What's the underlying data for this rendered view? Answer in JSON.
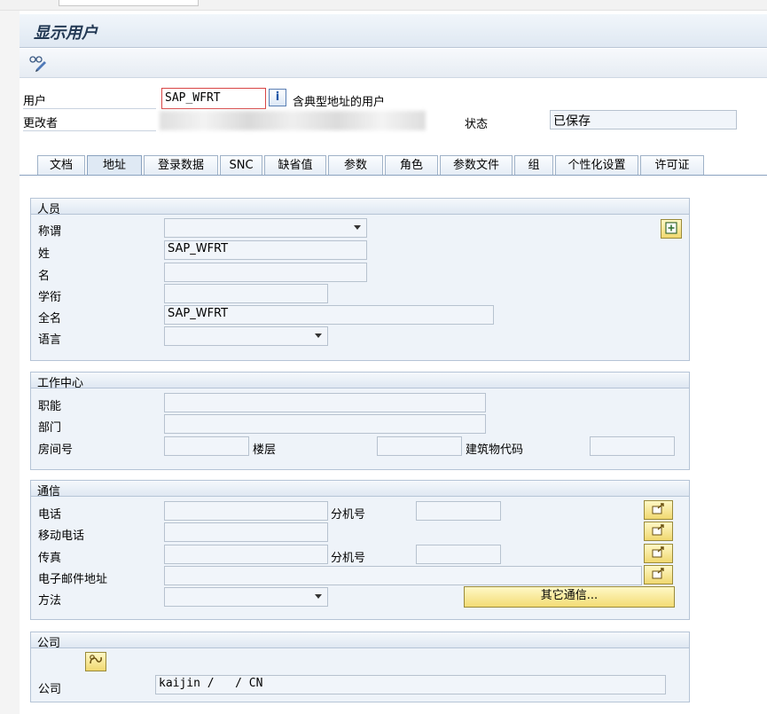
{
  "window": {
    "title": "显示用户"
  },
  "header": {
    "user_label": "用户",
    "user_value": "SAP_WFRT",
    "user_desc": "含典型地址的用户",
    "changed_by_label": "更改者",
    "status_label": "状态",
    "status_value": "已保存"
  },
  "tabs": [
    {
      "label": "文档",
      "active": false
    },
    {
      "label": "地址",
      "active": true
    },
    {
      "label": "登录数据",
      "active": false
    },
    {
      "label": "SNC",
      "active": false
    },
    {
      "label": "缺省值",
      "active": false
    },
    {
      "label": "参数",
      "active": false
    },
    {
      "label": "角色",
      "active": false
    },
    {
      "label": "参数文件",
      "active": false
    },
    {
      "label": "组",
      "active": false
    },
    {
      "label": "个性化设置",
      "active": false
    },
    {
      "label": "许可证",
      "active": false
    }
  ],
  "person": {
    "title": "人员",
    "salutation_label": "称谓",
    "salutation_value": "",
    "last_name_label": "姓",
    "last_name_value": "SAP_WFRT",
    "first_name_label": "名",
    "first_name_value": "",
    "academic_label": "学衔",
    "academic_value": "",
    "full_name_label": "全名",
    "full_name_value": "SAP_WFRT",
    "language_label": "语言",
    "language_value": ""
  },
  "work_center": {
    "title": "工作中心",
    "function_label": "职能",
    "department_label": "部门",
    "room_label": "房间号",
    "floor_label": "楼层",
    "building_label": "建筑物代码"
  },
  "communication": {
    "title": "通信",
    "phone_label": "电话",
    "ext_label": "分机号",
    "mobile_label": "移动电话",
    "fax_label": "传真",
    "fax_ext_label": "分机号",
    "email_label": "电子邮件地址",
    "method_label": "方法",
    "other_comm_button": "其它通信..."
  },
  "company": {
    "title": "公司",
    "company_label": "公司",
    "company_value": "kaijin /   / CN"
  }
}
